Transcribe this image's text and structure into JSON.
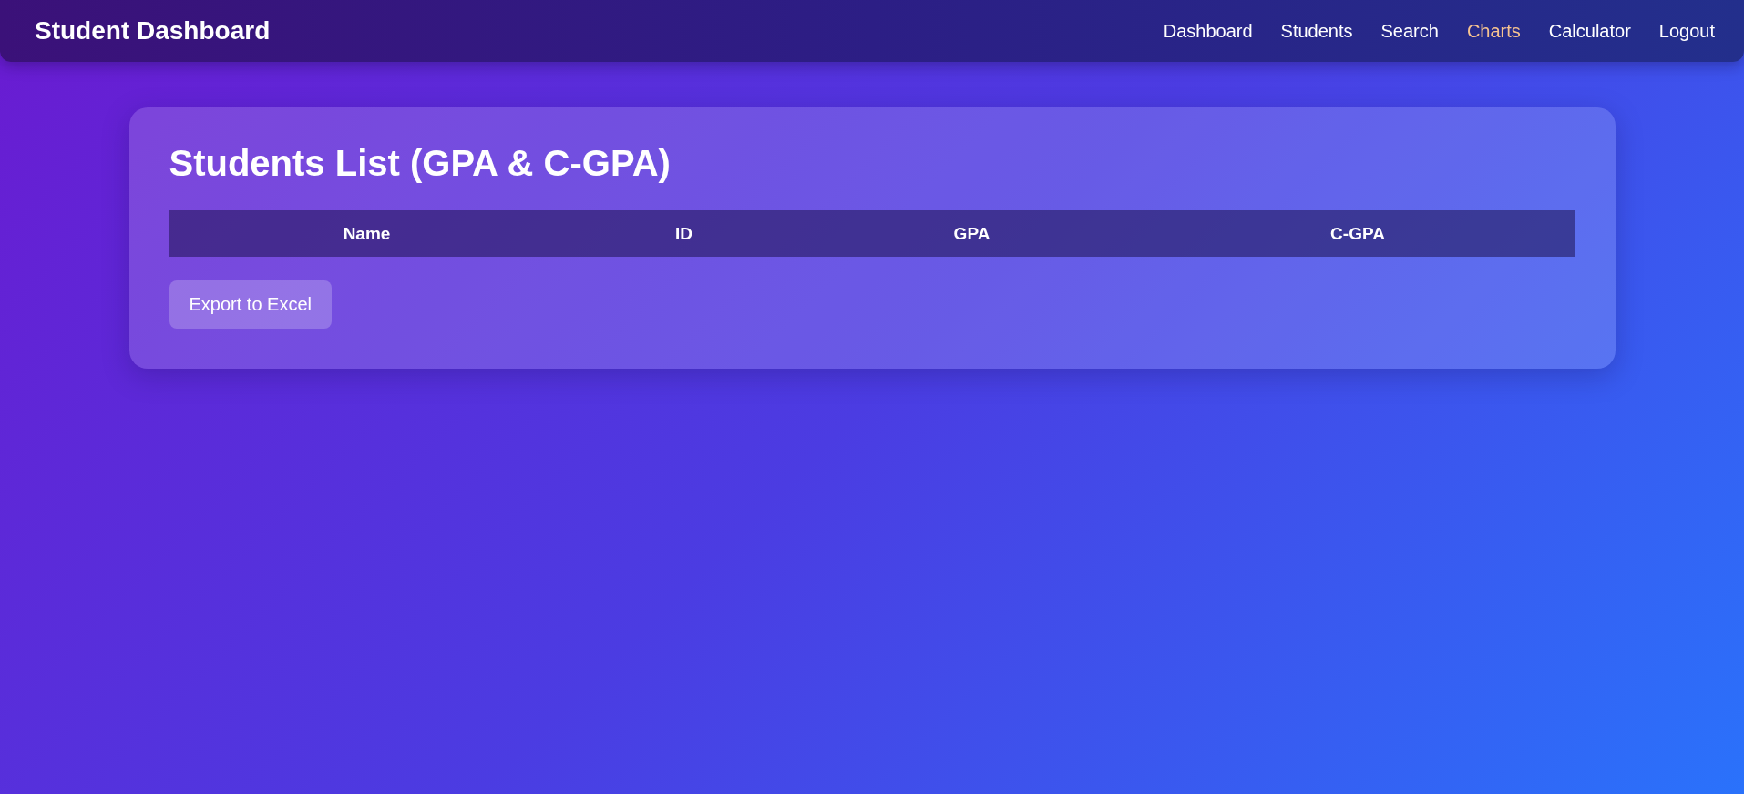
{
  "navbar": {
    "brand": "Student Dashboard",
    "links": [
      {
        "label": "Dashboard",
        "selected": false
      },
      {
        "label": "Students",
        "selected": false
      },
      {
        "label": "Search",
        "selected": false
      },
      {
        "label": "Charts",
        "selected": true
      },
      {
        "label": "Calculator",
        "selected": false
      },
      {
        "label": "Logout",
        "selected": false
      }
    ]
  },
  "card": {
    "title": "Students List (GPA & C-GPA)",
    "table": {
      "columns": [
        "Name",
        "ID",
        "GPA",
        "C-GPA"
      ]
    },
    "export_button": "Export to Excel"
  }
}
